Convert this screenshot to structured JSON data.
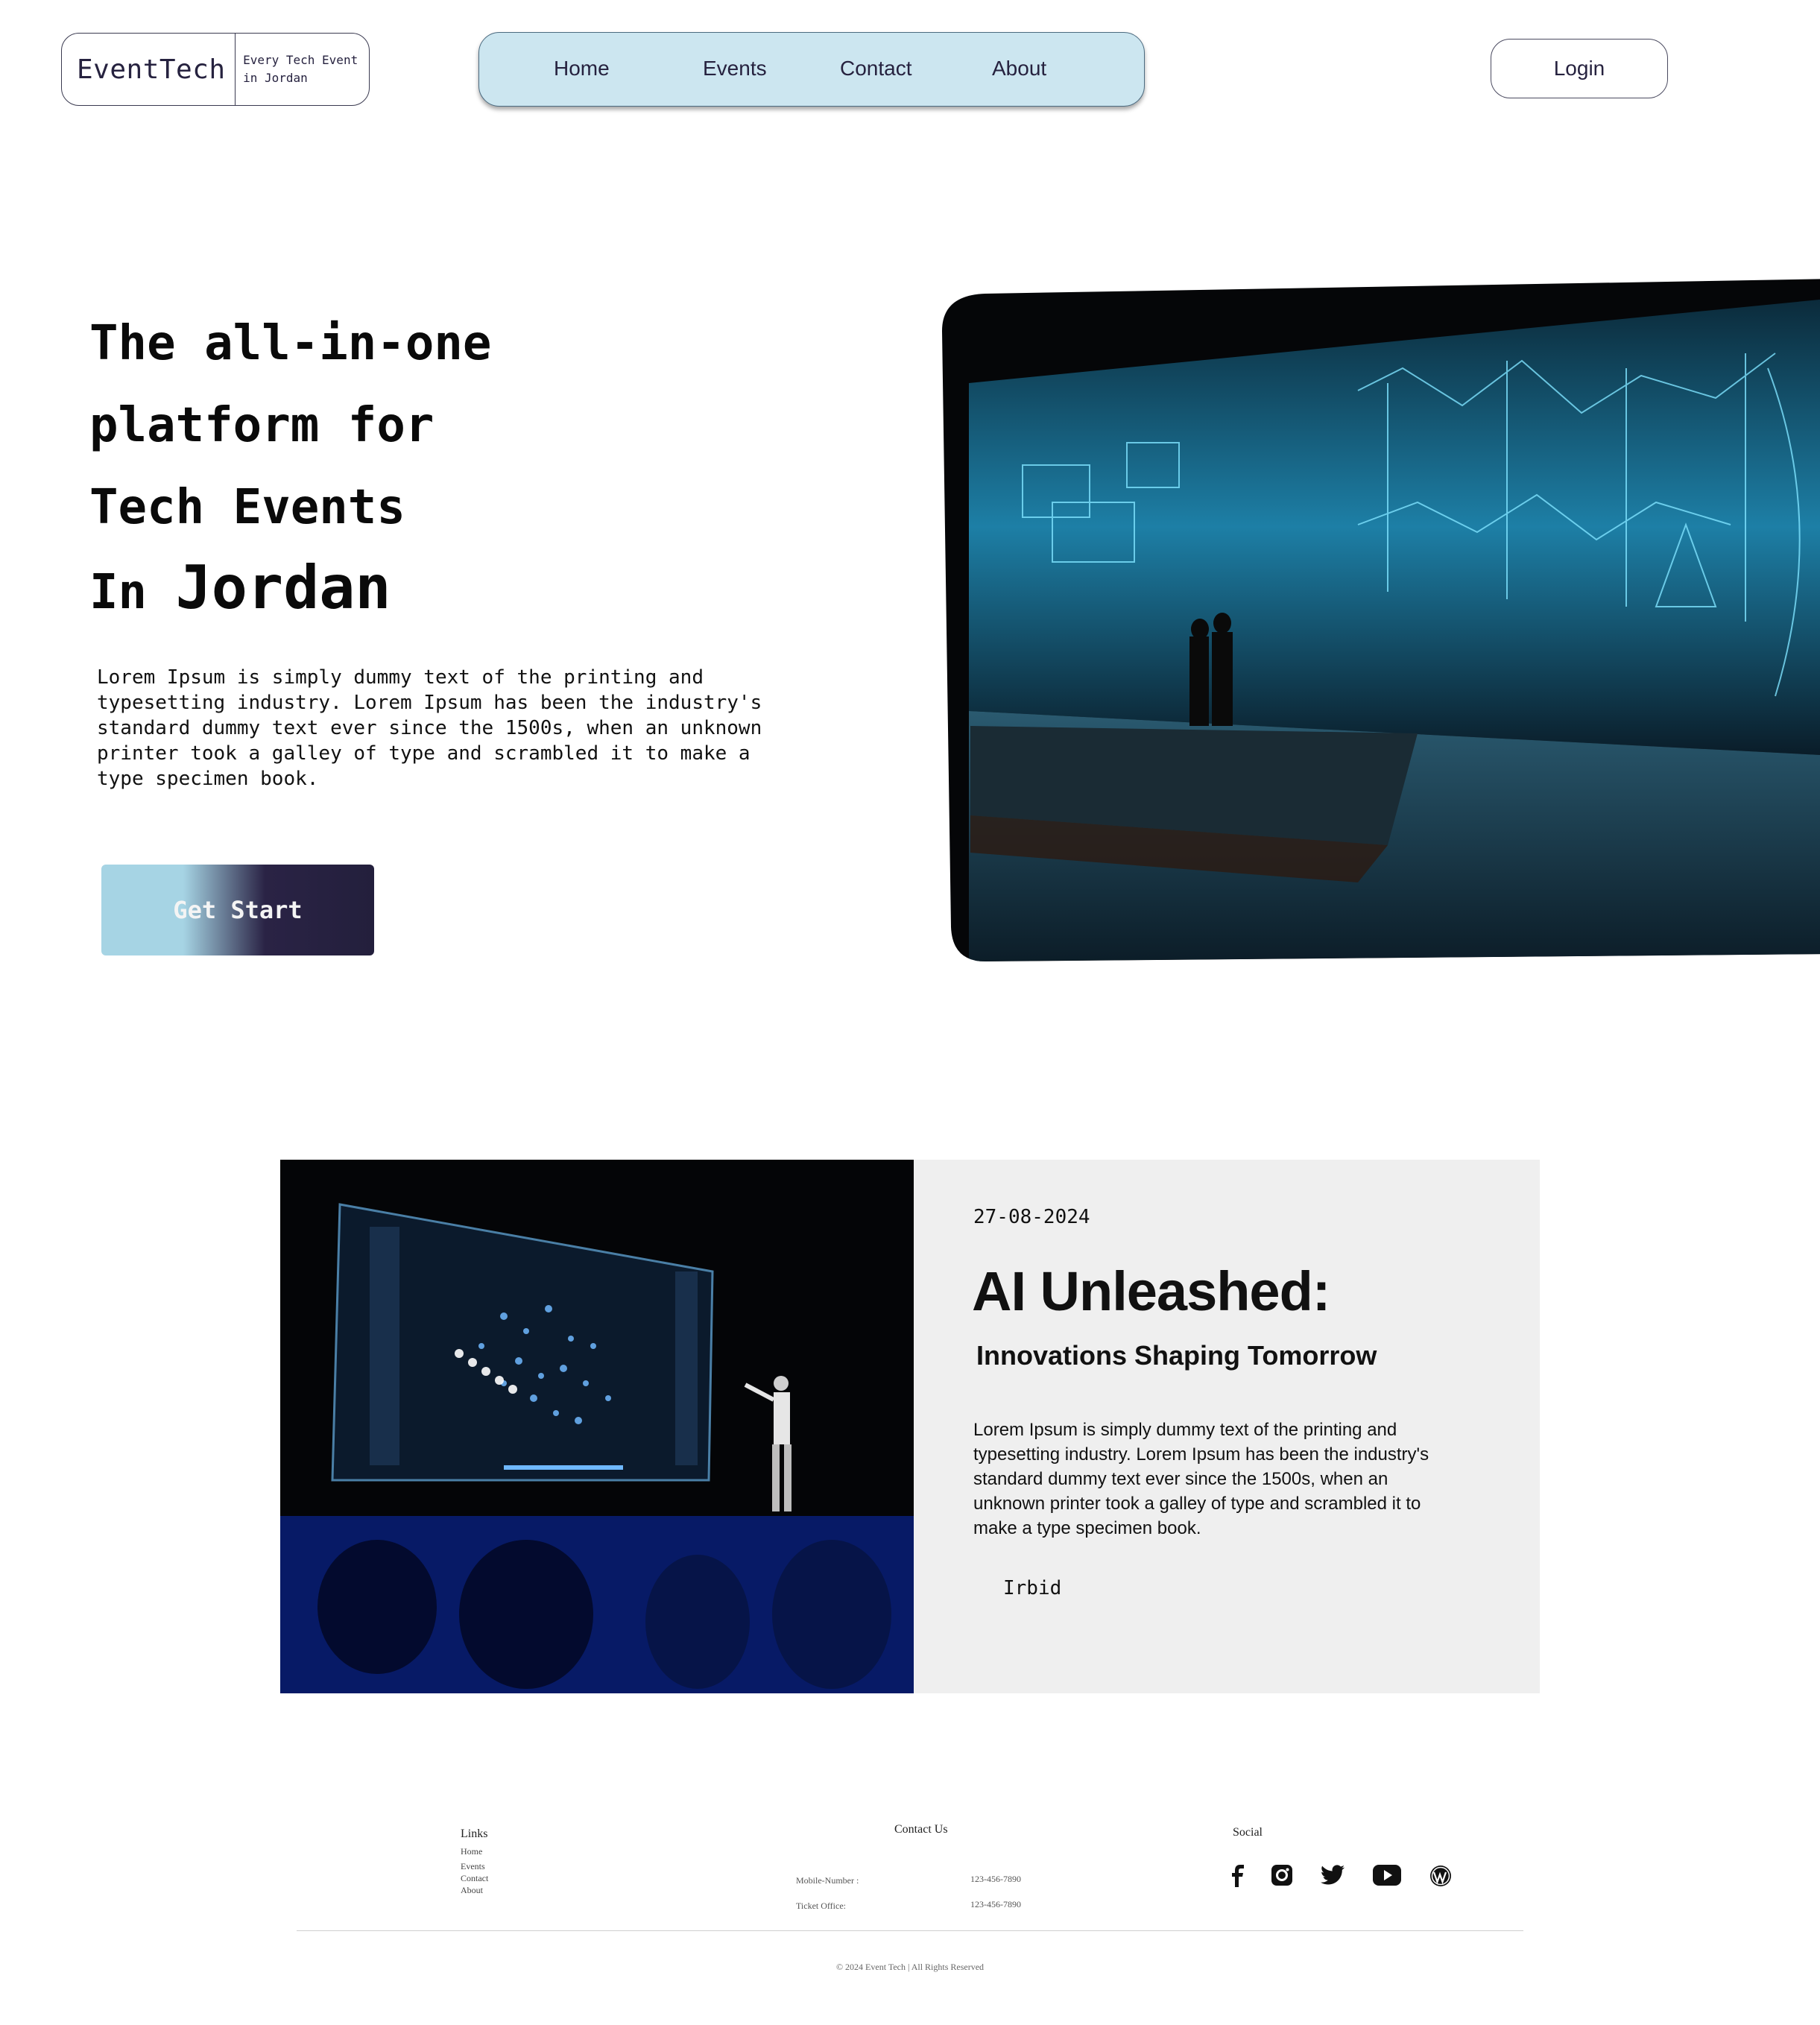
{
  "header": {
    "logo_name": "EventTech",
    "tagline_line1": "Every Tech Event",
    "tagline_line2": "in Jordan",
    "nav": [
      "Home",
      "Events",
      "Contact",
      "About"
    ],
    "login_label": "Login"
  },
  "hero": {
    "line1": "The all-in-one",
    "line2": "platform for",
    "line3": "Tech Events",
    "line4_small": "In",
    "line4_big": "Jordan",
    "description": "Lorem Ipsum is simply dummy text of the printing and\ntypesetting industry. Lorem Ipsum has been the industry's\nstandard dummy text ever since the 1500s, when an unknown\nprinter took a galley of type and scrambled it to make a\ntype specimen book.",
    "cta_label": "Get Start"
  },
  "event": {
    "date": "27-08-2024",
    "title": "AI Unleashed:",
    "subtitle": "Innovations Shaping Tomorrow",
    "description": "Lorem Ipsum is simply dummy text of the printing and typesetting industry. Lorem Ipsum has been the industry's standard dummy text ever since the 1500s, when an unknown printer took a galley of type and scrambled it to make a type specimen book.",
    "location": "Irbid"
  },
  "footer": {
    "links_heading": "Links",
    "links": [
      "Home",
      "Events",
      "Contact",
      "About"
    ],
    "contact_heading": "Contact Us",
    "contact_rows": [
      {
        "label": "Mobile-Number :",
        "value": "123-456-7890"
      },
      {
        "label": "Ticket Office:",
        "value": "123-456-7890"
      }
    ],
    "social_heading": "Social",
    "social_icons": [
      "facebook-icon",
      "instagram-icon",
      "twitter-icon",
      "youtube-icon",
      "wordpress-icon"
    ],
    "copyright": "© 2024 Event Tech | All Rights Reserved"
  },
  "colors": {
    "nav_bg": "#cce6f0",
    "cta_light": "#a6d4e4",
    "cta_dark": "#231f3c",
    "panel_bg": "#efefef",
    "text_dark": "#26223f"
  }
}
